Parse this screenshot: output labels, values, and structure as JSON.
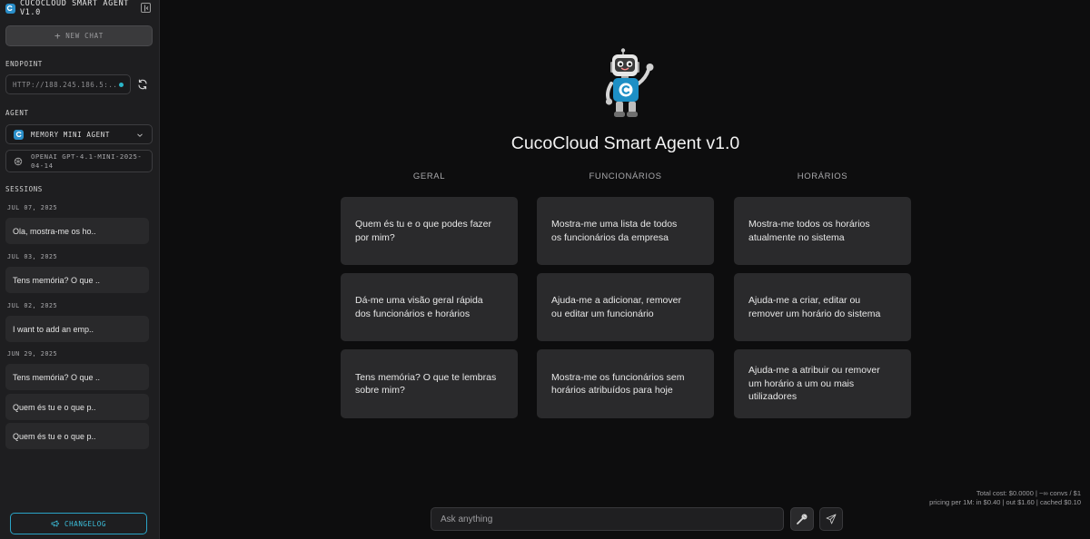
{
  "sidebar": {
    "app_title": "CUCOCLOUD SMART AGENT V1.0",
    "new_chat_label": "NEW CHAT",
    "endpoint_label": "ENDPOINT",
    "endpoint_value": "HTTP://188.245.186.5:..",
    "agent_label": "AGENT",
    "agent_selected": "MEMORY MINI AGENT",
    "model_line1": "OPENAI GPT-4.1-MINI-2025-",
    "model_line2": "04-14",
    "sessions_label": "SESSIONS",
    "sessions": [
      {
        "date": "JUL 07, 2025",
        "title": "Ola, mostra-me os ho.."
      },
      {
        "date": "JUL 03, 2025",
        "title": "Tens memória? O que .."
      },
      {
        "date": "JUL 02, 2025",
        "title": "I want to add an emp.."
      },
      {
        "date": "JUN 29, 2025",
        "title": "Tens memória? O que .."
      },
      {
        "date": "",
        "title": "Quem és tu e o que p.."
      },
      {
        "date": "",
        "title": "Quem és tu e o que p.."
      }
    ],
    "changelog_label": "CHANGELOG"
  },
  "main": {
    "title": "CucoCloud Smart Agent v1.0",
    "columns": [
      {
        "header": "GERAL",
        "cards": [
          [
            "Quem és tu e o que podes fazer",
            "por mim?"
          ],
          [
            "Dá-me uma visão geral rápida",
            "dos funcionários e horários"
          ],
          [
            "Tens memória? O que te lembras",
            "sobre mim?"
          ]
        ]
      },
      {
        "header": "FUNCIONÁRIOS",
        "cards": [
          [
            "Mostra-me uma lista de todos",
            "os funcionários da empresa"
          ],
          [
            "Ajuda-me a adicionar, remover",
            "ou editar um funcionário"
          ],
          [
            "Mostra-me os funcionários sem",
            "horários atribuídos para hoje"
          ]
        ]
      },
      {
        "header": "HORÁRIOS",
        "cards": [
          [
            "Mostra-me todos os horários",
            "atualmente no sistema"
          ],
          [
            "Ajuda-me a criar, editar ou",
            "remover um horário do sistema"
          ],
          [
            "Ajuda-me a atribuir ou remover",
            "um horário a um ou mais",
            "utilizadores"
          ]
        ]
      }
    ],
    "cost_line1": "Total cost: $0.0000 | ~∞ convs / $1",
    "cost_line2": "pricing per 1M: in $0.40 | out $1.60 | cached $0.10",
    "input_placeholder": "Ask anything"
  },
  "colors": {
    "accent": "#2a8ec9",
    "changelog": "#3cc0dd",
    "card_bg": "#2a2a2c",
    "sidebar_bg": "#1e1e20",
    "main_bg": "#0d0d0e"
  }
}
